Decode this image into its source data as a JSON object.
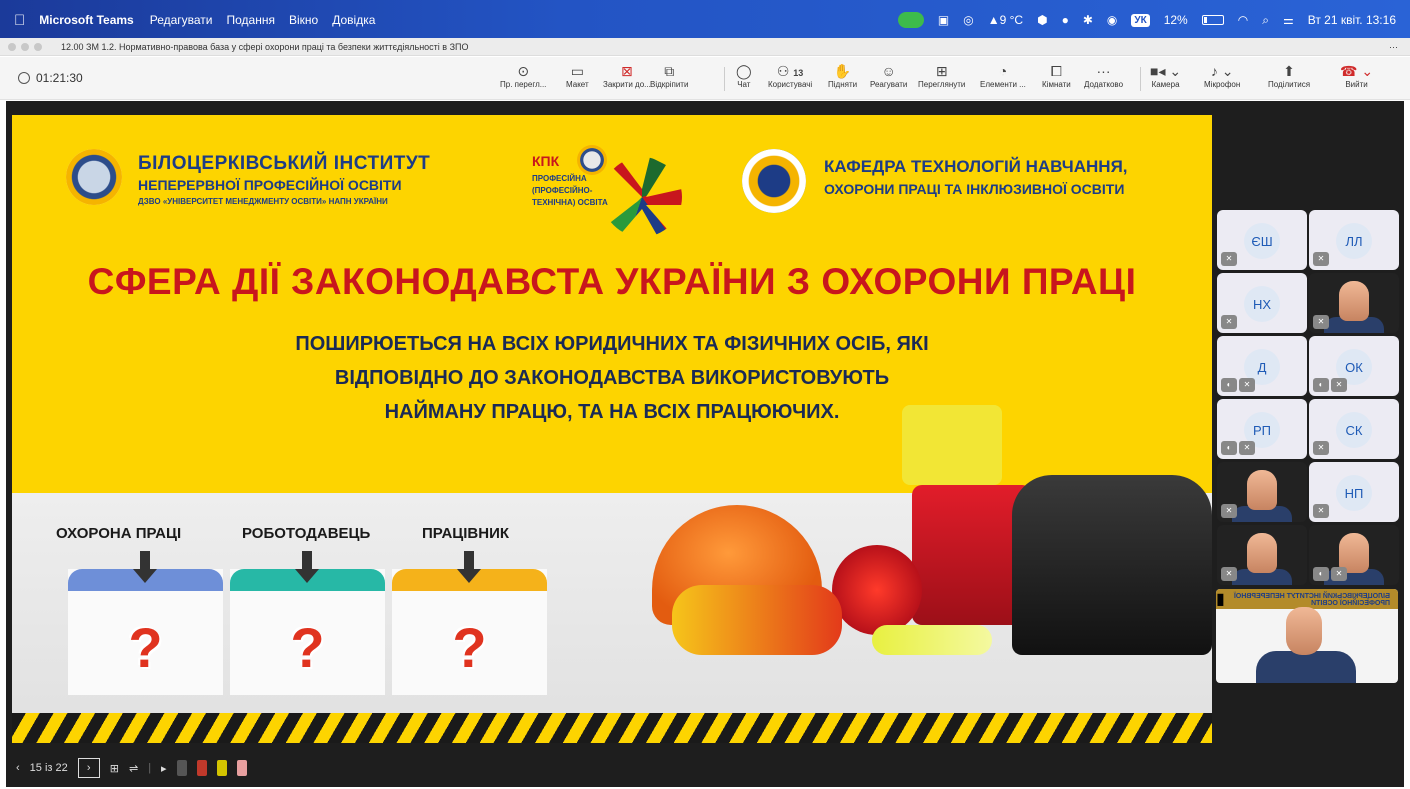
{
  "menubar": {
    "app_name": "Microsoft Teams",
    "items": [
      "Редагувати",
      "Подання",
      "Вікно",
      "Довідка"
    ],
    "weather": "9 °C",
    "kb_layout": "УК",
    "battery": "12%",
    "datetime": "Вт 21 квіт.  13:16"
  },
  "window": {
    "title": "12.00 ЗМ 1.2. Нормативно-правова база у сфері охорони праці та безпеки життєдіяльності в ЗПО",
    "more": "···"
  },
  "toolbar": {
    "timer": "01:21:30",
    "buttons": [
      {
        "label": "Пр. перегл...",
        "icon": "eye-icon"
      },
      {
        "label": "Макет",
        "icon": "layout-icon"
      },
      {
        "label": "Закрити до...",
        "icon": "close-icon"
      },
      {
        "label": "Відкріпити",
        "icon": "popout-icon"
      },
      {
        "label": "Чат",
        "icon": "chat-icon"
      },
      {
        "label": "Користувачі",
        "icon": "people-icon",
        "count": "13"
      },
      {
        "label": "Підняти",
        "icon": "hand-icon"
      },
      {
        "label": "Реагувати",
        "icon": "smile-icon"
      },
      {
        "label": "Переглянути",
        "icon": "grid-icon"
      },
      {
        "label": "Елементи ...",
        "icon": "apps-icon"
      },
      {
        "label": "Кімнати",
        "icon": "rooms-icon"
      },
      {
        "label": "Додатково",
        "icon": "more-icon"
      },
      {
        "label": "Камера",
        "icon": "camera-icon"
      },
      {
        "label": "Мікрофон",
        "icon": "mic-icon"
      },
      {
        "label": "Поділитися",
        "icon": "share-icon"
      },
      {
        "label": "Вийти",
        "icon": "hangup-icon"
      }
    ]
  },
  "slide": {
    "institute_line1": "БІЛОЦЕРКІВСЬКИЙ ІНСТИТУТ",
    "institute_line2": "НЕПЕРЕРВНОЇ ПРОФЕСІЙНОЇ ОСВІТИ",
    "institute_line3": "ДЗВО «УНІВЕРСИТЕТ МЕНЕДЖМЕНТУ ОСВІТИ» НАПН УКРАЇНИ",
    "kpk": "КПК",
    "kpk_text": "ПРОФЕСІЙНА (ПРОФЕСІЙНО-ТЕХНІЧНА) ОСВІТА",
    "department_line1": "КАФЕДРА ТЕХНОЛОГІЙ НАВЧАННЯ,",
    "department_line2": "ОХОРОНИ ПРАЦІ ТА ІНКЛЮЗИВНОЇ ОСВІТИ",
    "headline": "СФЕРА ДІЇ ЗАКОНОДАВСТА УКРАЇНИ З ОХОРОНИ ПРАЦІ",
    "sub_line1": "ПОШИРЮЕТЬСЯ НА ВСІХ ЮРИДИЧНИХ ТА ФІЗИЧНИХ ОСІБ, ЯКІ",
    "sub_line2": "ВІДПОВІДНО ДО ЗАКОНОДАВСТВА ВИКОРИСТОВУЮТЬ",
    "sub_line3": "НАЙМАНУ ПРАЦЮ, ТА НА ВСІХ ПРАЦЮЮЧИХ.",
    "columns": [
      {
        "heading": "ОХОРОНА ПРАЦІ",
        "color": "#6e8fd8",
        "mark": "?"
      },
      {
        "heading": "РОБОТОДАВЕЦЬ",
        "color": "#27b8a6",
        "mark": "?"
      },
      {
        "heading": "ПРАЦІВНИК",
        "color": "#f5b21a",
        "mark": "?"
      }
    ]
  },
  "slide_controls": {
    "prev": "‹",
    "counter": "15 із 22",
    "next": "›"
  },
  "participants": [
    {
      "initials": "ЄШ"
    },
    {
      "initials": "ЛЛ"
    },
    {
      "initials": "НХ"
    },
    {
      "initials": ""
    },
    {
      "initials": "Д"
    },
    {
      "initials": "ОК"
    },
    {
      "initials": "РП"
    },
    {
      "initials": "СК"
    },
    {
      "initials": ""
    },
    {
      "initials": "НП"
    },
    {
      "initials": ""
    },
    {
      "initials": ""
    }
  ],
  "presenter_tile_text": "БІЛОЦЕРКІВСЬКИЙ ІНСТИТУТ НЕПЕРЕРВНОЇ ПРОФЕСІЙНОЇ ОСВІТИ"
}
